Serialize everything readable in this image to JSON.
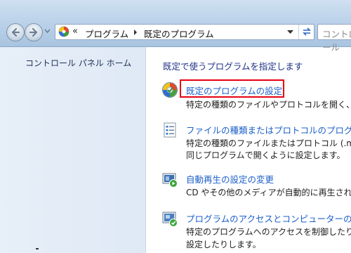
{
  "address_bar": {
    "overflow_marker": "«",
    "breadcrumbs": [
      "プログラム",
      "既定のプログラム"
    ]
  },
  "search": {
    "placeholder": "コントロール"
  },
  "sidebar": {
    "home_link": "コントロール パネル ホーム"
  },
  "main": {
    "heading": "既定で使うプログラムを指定します",
    "items": [
      {
        "icon": "default-programs-icon",
        "title": "既定のプログラムの設定",
        "description": [
          "特定の種類のファイルやプロトコルを開く、"
        ]
      },
      {
        "icon": "file-association-icon",
        "title": "ファイルの種類またはプロトコルのプログラ",
        "description": [
          "特定の種類のファイルまたはプロトコル (.m",
          "同じプログラムで開くように設定します。"
        ]
      },
      {
        "icon": "autoplay-icon",
        "title": "自動再生の設定の変更",
        "description": [
          "CD やその他のメディアが自動的に再生され"
        ]
      },
      {
        "icon": "program-access-icon",
        "title": "プログラムのアクセスとコンピューターの既",
        "description": [
          "特定のプログラムへのアクセスを制御したり",
          "設定したりします。"
        ]
      }
    ]
  },
  "colors": {
    "link": "#1c5fc9",
    "heading": "#1e3287",
    "highlight_border": "#e60012",
    "sidebar_bg": "#e3ecf7",
    "toolbar_bg": "#bcd3ea"
  }
}
